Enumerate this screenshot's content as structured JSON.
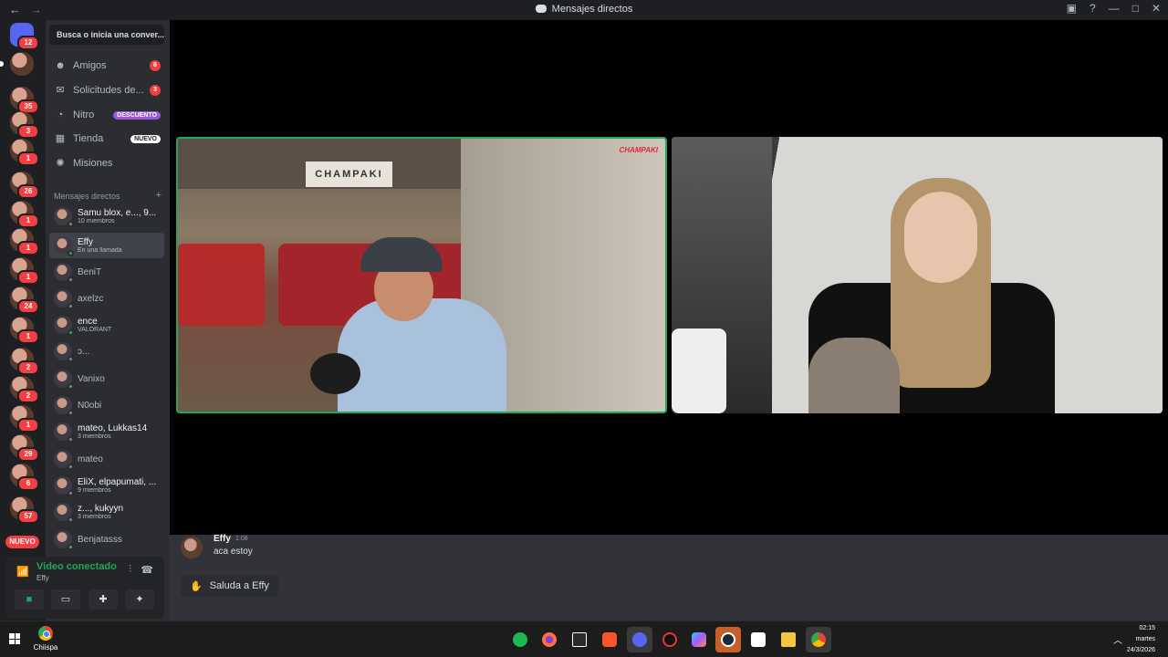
{
  "window": {
    "title": "Mensajes directos",
    "back": "←",
    "forward": "→",
    "controls": [
      "▣",
      "?",
      "—",
      "□",
      "✕"
    ]
  },
  "colors": {
    "accent": "#5865f2",
    "online": "#23a55a",
    "danger": "#f23f43",
    "nitro": "#9b59d6"
  },
  "servers": [
    {
      "badge": "12",
      "icon": "discord-icon"
    },
    {
      "badge": "",
      "icon": "avatar"
    },
    {
      "badge": "35"
    },
    {
      "badge": "3"
    },
    {
      "badge": "1"
    },
    {
      "badge": "26"
    },
    {
      "badge": "1"
    },
    {
      "badge": "1"
    },
    {
      "badge": "1"
    },
    {
      "badge": "24"
    },
    {
      "badge": "1"
    },
    {
      "badge": "2"
    },
    {
      "badge": "2"
    },
    {
      "badge": "1"
    },
    {
      "badge": "29"
    },
    {
      "badge": "6"
    },
    {
      "badge": "57"
    }
  ],
  "new_pill": "NUEVO",
  "search": {
    "label": "Busca o inicia una conver..."
  },
  "nav": {
    "friends": {
      "label": "Amigos",
      "count": "8"
    },
    "requests": {
      "label": "Solicitudes de...",
      "count": "3"
    },
    "nitro": {
      "label": "Nitro",
      "tag": "DESCUENTO"
    },
    "shop": {
      "label": "Tienda",
      "tag": "NUEVO"
    },
    "quests": {
      "label": "Misiones"
    }
  },
  "dm_header": {
    "label": "Mensajes directos",
    "add": "+"
  },
  "dms": [
    {
      "name": "Samu blox, e..., 9...",
      "sub": "10 miembros"
    },
    {
      "name": "Effy",
      "sub": "En una llamada"
    },
    {
      "name": "BeniT",
      "sub": ""
    },
    {
      "name": "axelzc",
      "sub": ""
    },
    {
      "name": "ence",
      "sub": "VALORANT"
    },
    {
      "name": "ↄ...",
      "sub": ""
    },
    {
      "name": "Vanixo",
      "sub": ""
    },
    {
      "name": "N0obi",
      "sub": ""
    },
    {
      "name": "mateo, Lukkas14",
      "sub": "3 miembros"
    },
    {
      "name": "mateo",
      "sub": ""
    },
    {
      "name": "EliX, elpapumati, ...",
      "sub": "9 miembros"
    },
    {
      "name": "z..., kukyyn",
      "sub": "3 miembros"
    },
    {
      "name": "Benjatasss",
      "sub": ""
    }
  ],
  "voice": {
    "status": "Video conectado",
    "channel": "Effy"
  },
  "video_overlay": {
    "stream_logo": "CHAMPAKI"
  },
  "message": {
    "author": "Effy",
    "time": "1:08",
    "body": "aca estoy"
  },
  "wave": {
    "label": "Saluda a Effy"
  },
  "taskbar": {
    "pinned_label": "Chiispa",
    "clock_time": "02:15",
    "clock_day": "martes",
    "clock_date": "24/3/2026"
  }
}
